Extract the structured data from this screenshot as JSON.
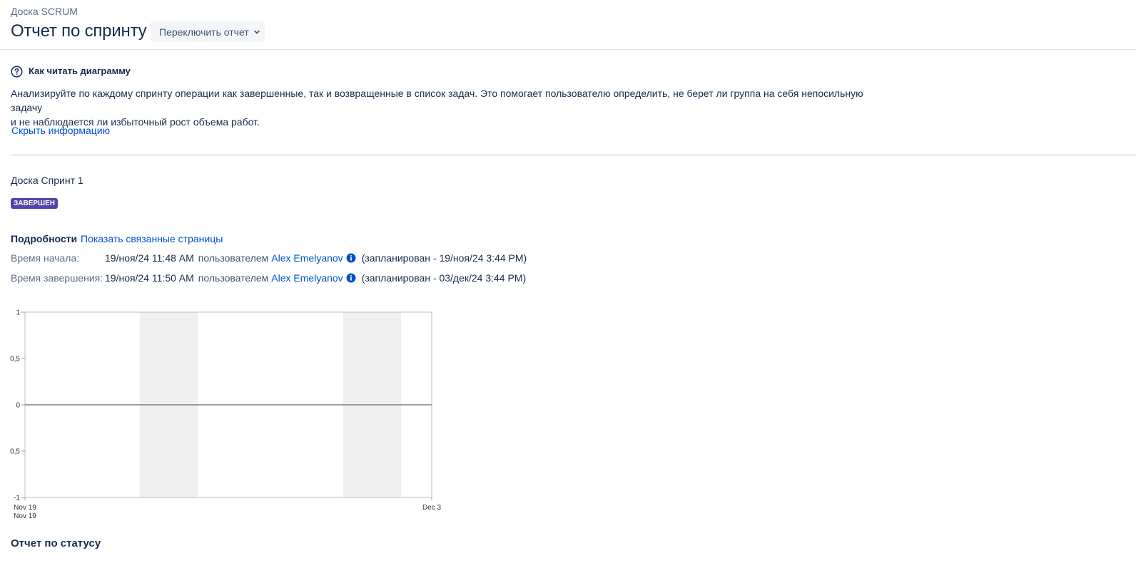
{
  "header": {
    "breadcrumb": "Доска SCRUM",
    "title": "Отчет по спринту",
    "switch_report_label": "Переключить отчет"
  },
  "help": {
    "title": "Как читать диаграмму",
    "line1": "Анализируйте по каждому спринту операции как завершенные, так и возвращенные в список задач. Это помогает пользователю определить, не берет ли группа на себя непосильную задачу",
    "line2": "и не наблюдается ли избыточный рост объема работ.",
    "hide_link": "Скрыть информацию"
  },
  "sprint": {
    "name": "Доска Спринт 1",
    "status": "ЗАВЕРШЕН"
  },
  "details": {
    "label": "Подробности",
    "related_link": "Показать связанные страницы",
    "by_label": "пользователем",
    "start": {
      "label": "Время начала:",
      "value": "19/ноя/24 11:48 AM",
      "user": "Alex Emelyanov",
      "planned": "(запланирован - 19/ноя/24 3:44 PM)"
    },
    "end": {
      "label": "Время завершения:",
      "value": "19/ноя/24 11:50 AM",
      "user": "Alex Emelyanov",
      "planned": "(запланирован - 03/дек/24 3:44 PM)"
    }
  },
  "chart_data": {
    "type": "line",
    "ylim": [
      -1,
      1
    ],
    "y_ticks": [
      "1",
      "0,5",
      "0",
      "0,5",
      "-1"
    ],
    "x_ticks": [
      "Nov 19",
      "Dec 3"
    ],
    "x_start_second_label": "Nov 19",
    "series": [
      {
        "values": [
          0,
          0
        ]
      }
    ],
    "weekend_bands": [
      [
        "Nov 23",
        "Nov 25"
      ],
      [
        "Nov 30",
        "Dec 2"
      ]
    ],
    "grid": false,
    "colors": {
      "line": "#808080",
      "band": "#f0f0f0",
      "axis": "#bbbbbb"
    }
  },
  "status_report": {
    "title": "Отчет по статусу"
  }
}
